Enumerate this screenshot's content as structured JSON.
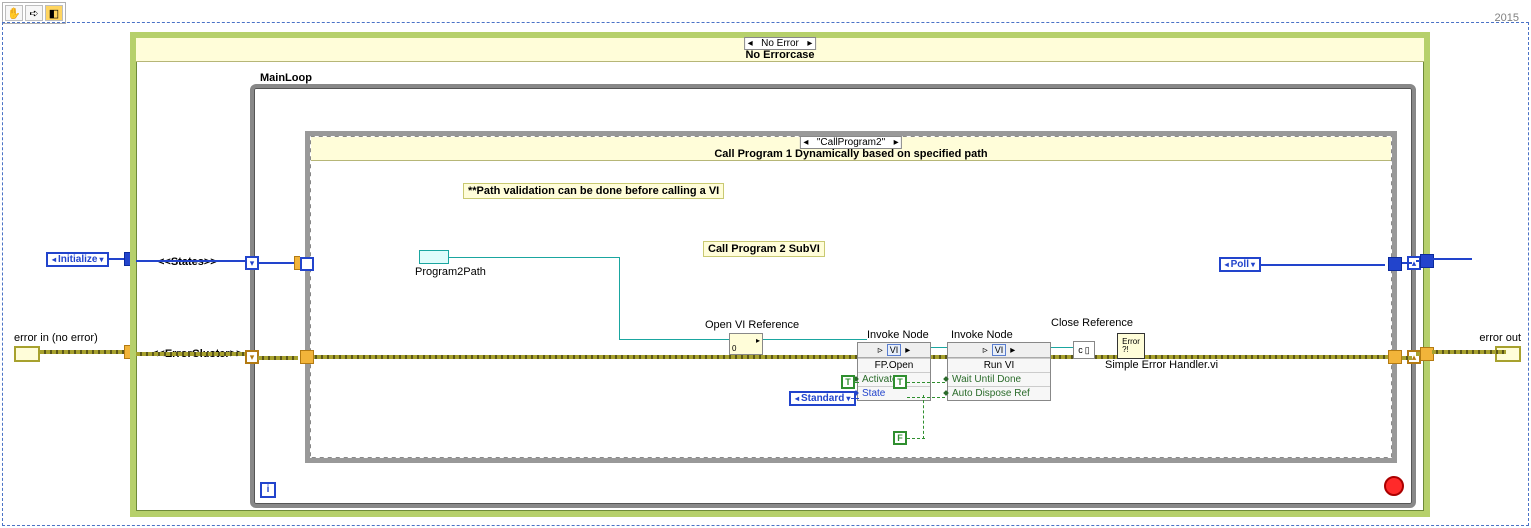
{
  "version_label": "2015",
  "toolbar": {
    "pan_tool": "✋",
    "arrow_tool": "➪",
    "probe_tool": "◧"
  },
  "error_in_label": "error in (no error)",
  "error_out_label": "error out",
  "states_label": "<<States>>",
  "errorcluster_label": "<<ErrorCluster>>",
  "initialize_ring": "Initialize",
  "poll_ring": "Poll",
  "standard_ring": "Standard",
  "outer_case": {
    "selector": "No Error",
    "title": "No Errorcase"
  },
  "mainloop_label": "MainLoop",
  "inner_case": {
    "selector": "\"CallProgram2\"",
    "title": "Call Program 1 Dynamically based on specified path"
  },
  "path_note": "**Path validation can be done before calling a VI",
  "subvi_note": "Call Program 2 SubVI",
  "program2path_label": "Program2Path",
  "openvi_label": "Open VI Reference",
  "openvi_opt": "0",
  "invoke1": {
    "label": "Invoke Node",
    "class": "VI",
    "method": "FP.Open",
    "params": [
      "Activate",
      "State"
    ]
  },
  "invoke2": {
    "label": "Invoke Node",
    "class": "VI",
    "method": "Run VI",
    "params": [
      "Wait Until Done",
      "Auto Dispose Ref"
    ]
  },
  "close_ref_label": "Close Reference",
  "close_ref_icon": "c",
  "seh_label": "Simple Error Handler.vi",
  "seh_icon": "Error?!",
  "bool_true": "T",
  "bool_false": "F",
  "i_terminal": "i"
}
